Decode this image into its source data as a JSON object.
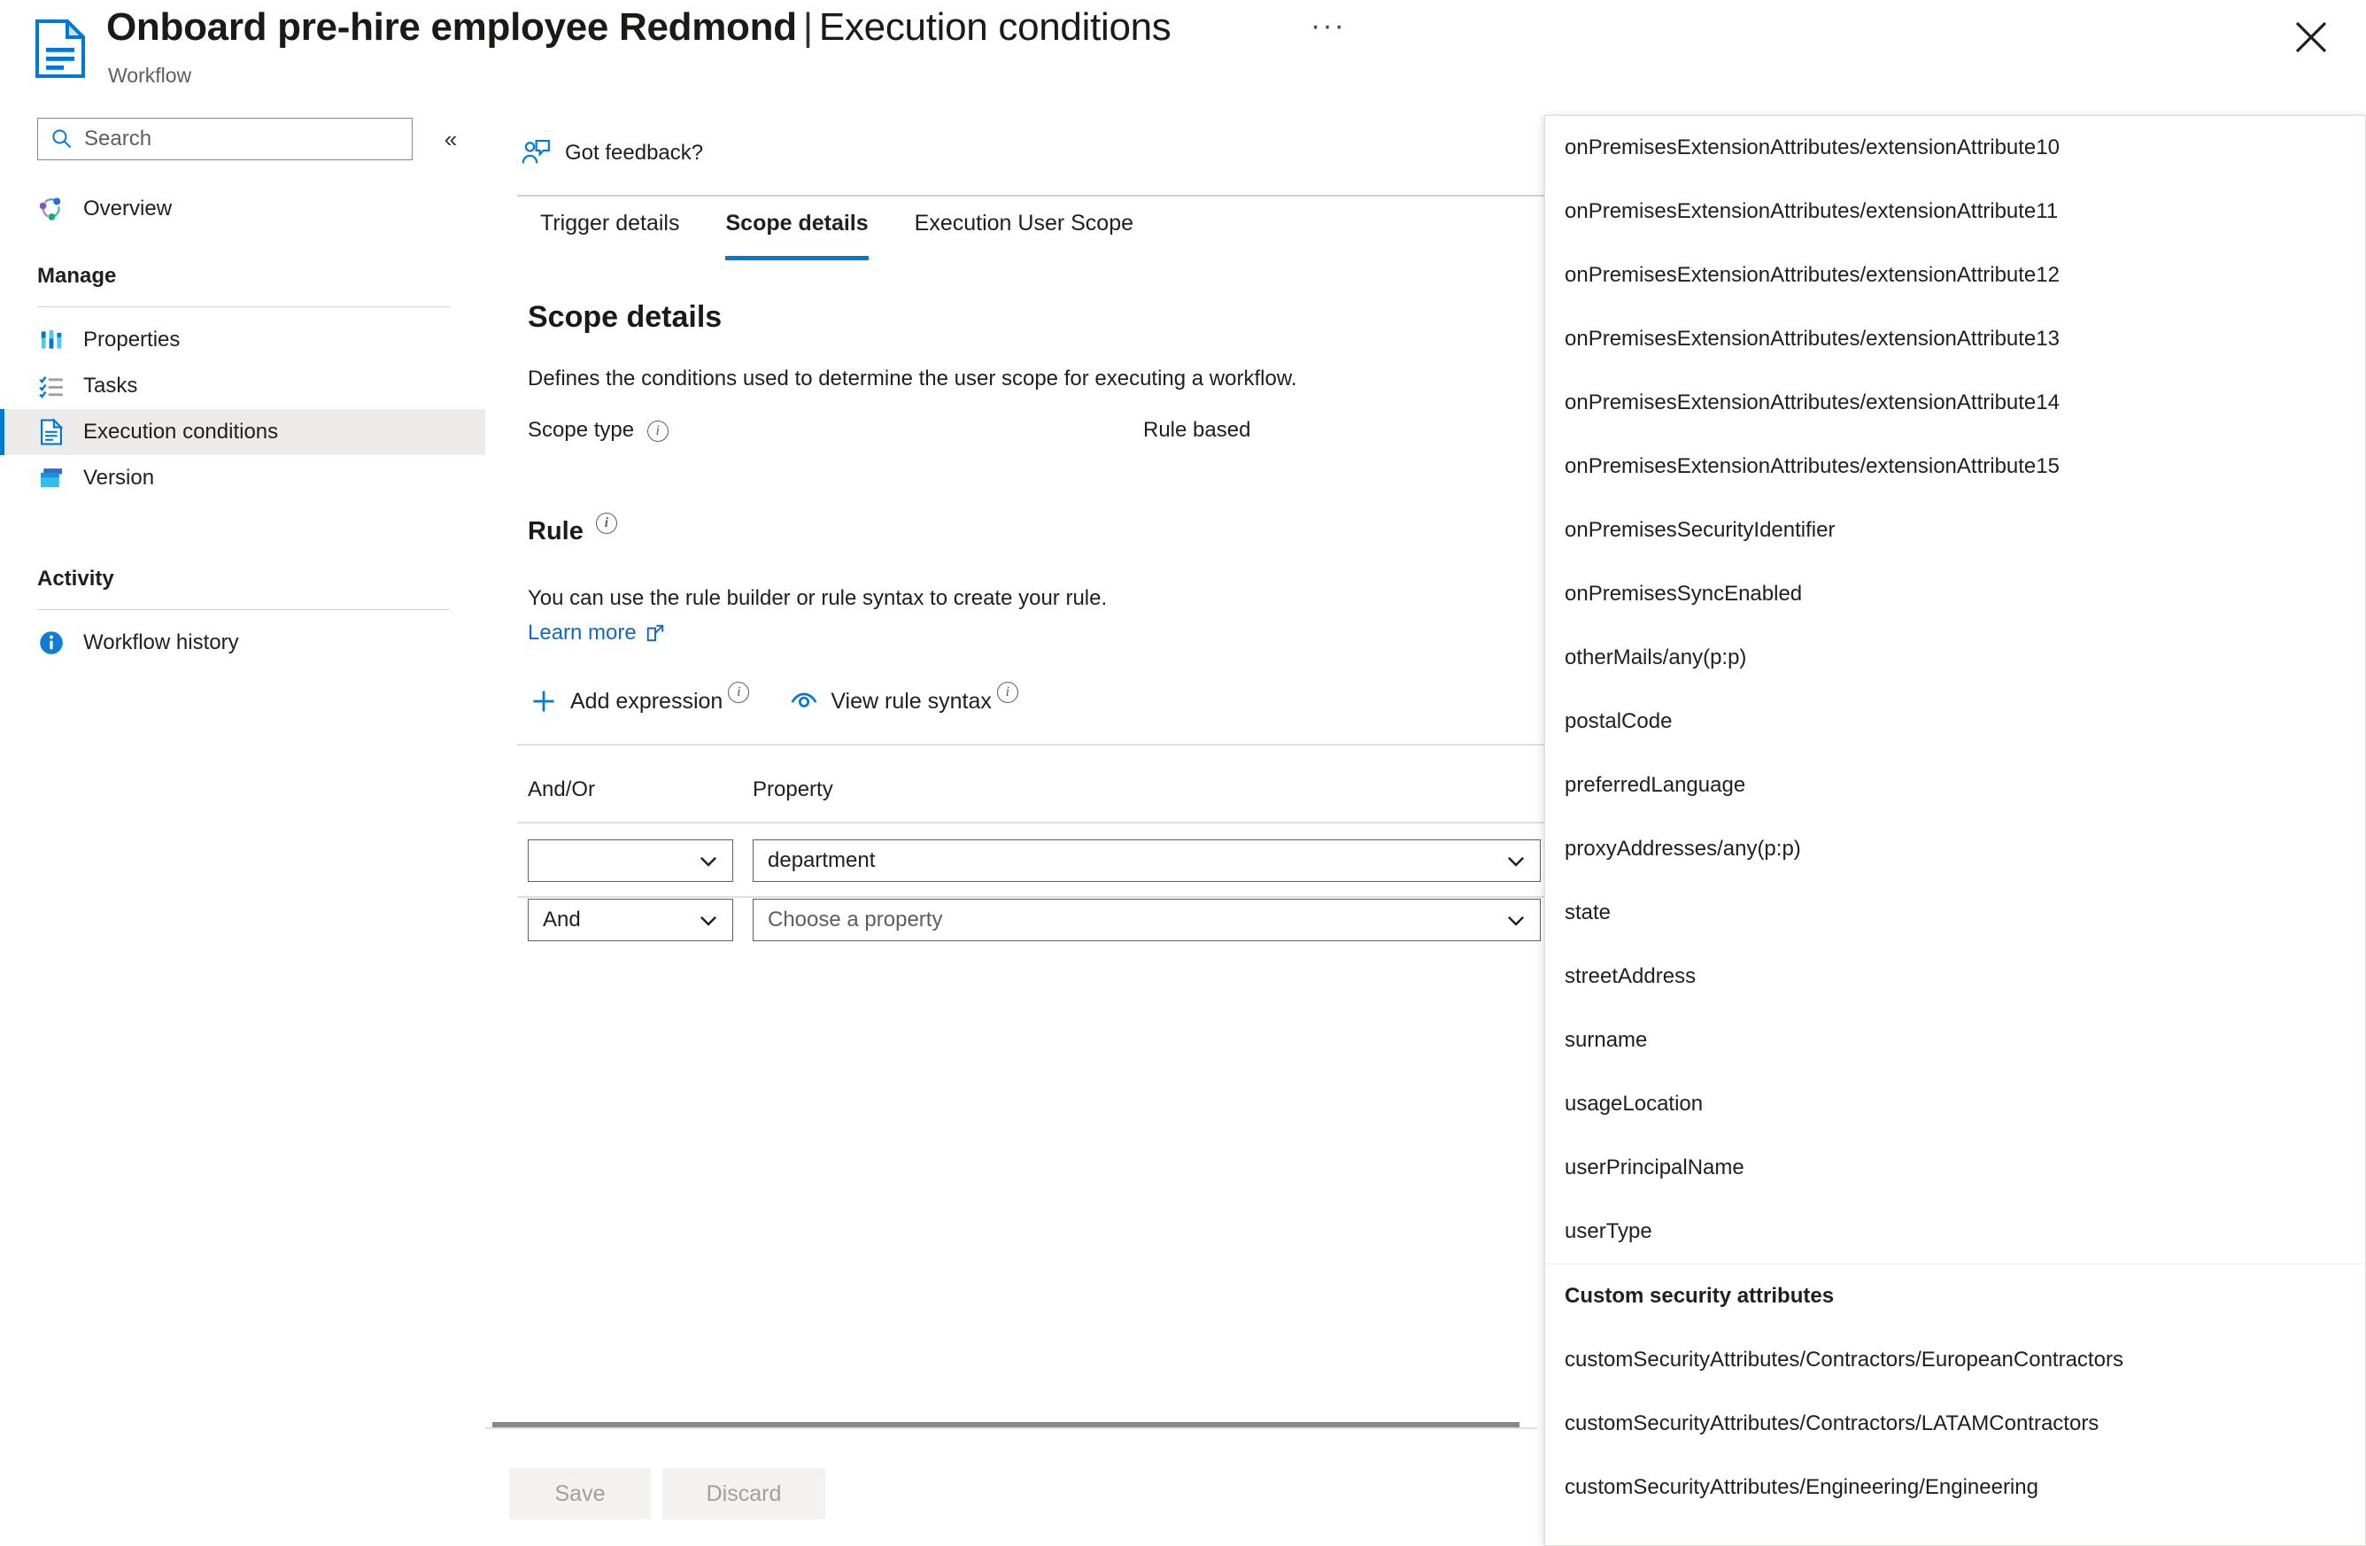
{
  "header": {
    "title_main": "Onboard pre-hire employee Redmond",
    "title_separator": "|",
    "title_section": "Execution conditions",
    "subtitle": "Workflow",
    "ellipsis": "···",
    "icon": "workflow-document-icon",
    "close_icon": "close-icon"
  },
  "sidebar": {
    "search": {
      "placeholder": "Search",
      "value": "",
      "icon": "search-icon"
    },
    "collapse_icon": "chevron-double-left-icon",
    "overview": {
      "label": "Overview",
      "icon": "overview-icon"
    },
    "manage_header": "Manage",
    "activity_header": "Activity",
    "manage_items": [
      {
        "label": "Properties",
        "icon": "properties-icon",
        "selected": false
      },
      {
        "label": "Tasks",
        "icon": "tasks-checklist-icon",
        "selected": false
      },
      {
        "label": "Execution conditions",
        "icon": "document-icon",
        "selected": true
      },
      {
        "label": "Version",
        "icon": "version-stack-icon",
        "selected": false
      }
    ],
    "activity_items": [
      {
        "label": "Workflow history",
        "icon": "info-circle-icon",
        "selected": false
      }
    ]
  },
  "content": {
    "feedback": {
      "label": "Got feedback?",
      "icon": "feedback-person-icon"
    },
    "tabs": [
      {
        "label": "Trigger details",
        "active": false
      },
      {
        "label": "Scope details",
        "active": true
      },
      {
        "label": "Execution User Scope",
        "active": false
      }
    ],
    "pane": {
      "title": "Scope details",
      "description": "Defines the conditions used to determine the user scope for executing a workflow.",
      "scope_type_label": "Scope type",
      "scope_type_value": "Rule based",
      "rule_title": "Rule",
      "rule_description": "You can use the rule builder or rule syntax to create your rule.",
      "learn_more": "Learn more",
      "learn_more_icon": "external-link-icon",
      "commands": [
        {
          "label": "Add expression",
          "icon": "plus-icon",
          "has_info": true
        },
        {
          "label": "View rule syntax",
          "icon": "eye-icon",
          "has_info": true
        }
      ],
      "columns": [
        {
          "label": "And/Or"
        },
        {
          "label": "Property"
        }
      ],
      "rows": [
        {
          "andor_value": "",
          "andor_placeholder": "",
          "property_value": "department",
          "property_is_placeholder": false
        },
        {
          "andor_value": "And",
          "andor_placeholder": "",
          "property_value": "Choose a property",
          "property_is_placeholder": true
        }
      ]
    },
    "footer": {
      "save_label": "Save",
      "discard_label": "Discard",
      "save_enabled": false,
      "discard_enabled": false
    }
  },
  "property_dropdown": {
    "items": [
      "onPremisesExtensionAttributes/extensionAttribute10",
      "onPremisesExtensionAttributes/extensionAttribute11",
      "onPremisesExtensionAttributes/extensionAttribute12",
      "onPremisesExtensionAttributes/extensionAttribute13",
      "onPremisesExtensionAttributes/extensionAttribute14",
      "onPremisesExtensionAttributes/extensionAttribute15",
      "onPremisesSecurityIdentifier",
      "onPremisesSyncEnabled",
      "otherMails/any(p:p)",
      "postalCode",
      "preferredLanguage",
      "proxyAddresses/any(p:p)",
      "state",
      "streetAddress",
      "surname",
      "usageLocation",
      "userPrincipalName",
      "userType"
    ],
    "group_header": "Custom security attributes",
    "group_items": [
      "customSecurityAttributes/Contractors/EuropeanContractors",
      "customSecurityAttributes/Contractors/LATAMContractors",
      "customSecurityAttributes/Engineering/Engineering"
    ]
  },
  "colors": {
    "accent": "#0078d4",
    "link": "#0f6cbd",
    "selected_bg": "#edebe9",
    "border": "#8a8886",
    "text": "#201f1e",
    "muted": "#605e5c"
  }
}
